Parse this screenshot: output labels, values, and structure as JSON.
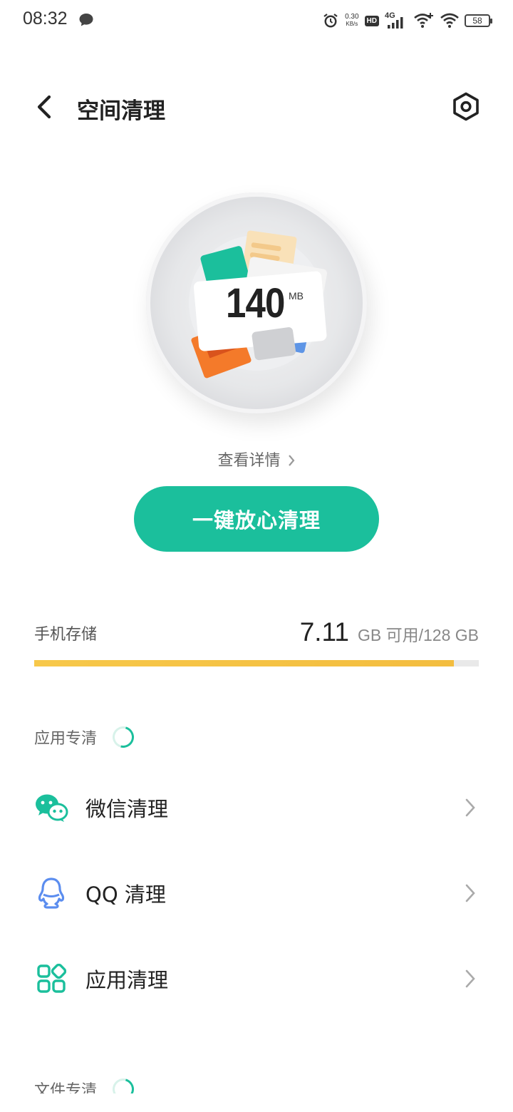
{
  "status_bar": {
    "time": "08:32",
    "net_speed_value": "0.30",
    "net_speed_unit": "KB/s",
    "hd_badge": "HD",
    "network_type": "4G",
    "battery_level": "58"
  },
  "header": {
    "title": "空间清理",
    "back_icon": "chevron-left-icon",
    "settings_icon": "settings-icon"
  },
  "hero": {
    "junk_size": "140",
    "junk_unit": "MB",
    "details_link": "查看详情",
    "clean_button": "一键放心清理"
  },
  "storage": {
    "label": "手机存储",
    "available": "7.11",
    "rest_text": "GB 可用/128 GB",
    "used_fraction": 0.944,
    "bar_color": "#f6c343"
  },
  "sections": {
    "app_clean": {
      "title": "应用专清",
      "items": [
        {
          "label": "微信清理",
          "icon": "wechat-icon",
          "color": "#1bbf9c"
        },
        {
          "label": "QQ 清理",
          "icon": "qq-icon",
          "color": "#5b8def"
        },
        {
          "label": "应用清理",
          "icon": "apps-icon",
          "color": "#1bbf9c"
        }
      ]
    },
    "file_clean": {
      "title": "文件专清"
    }
  },
  "colors": {
    "accent": "#1bbf9c",
    "qq_blue": "#5b8def"
  }
}
